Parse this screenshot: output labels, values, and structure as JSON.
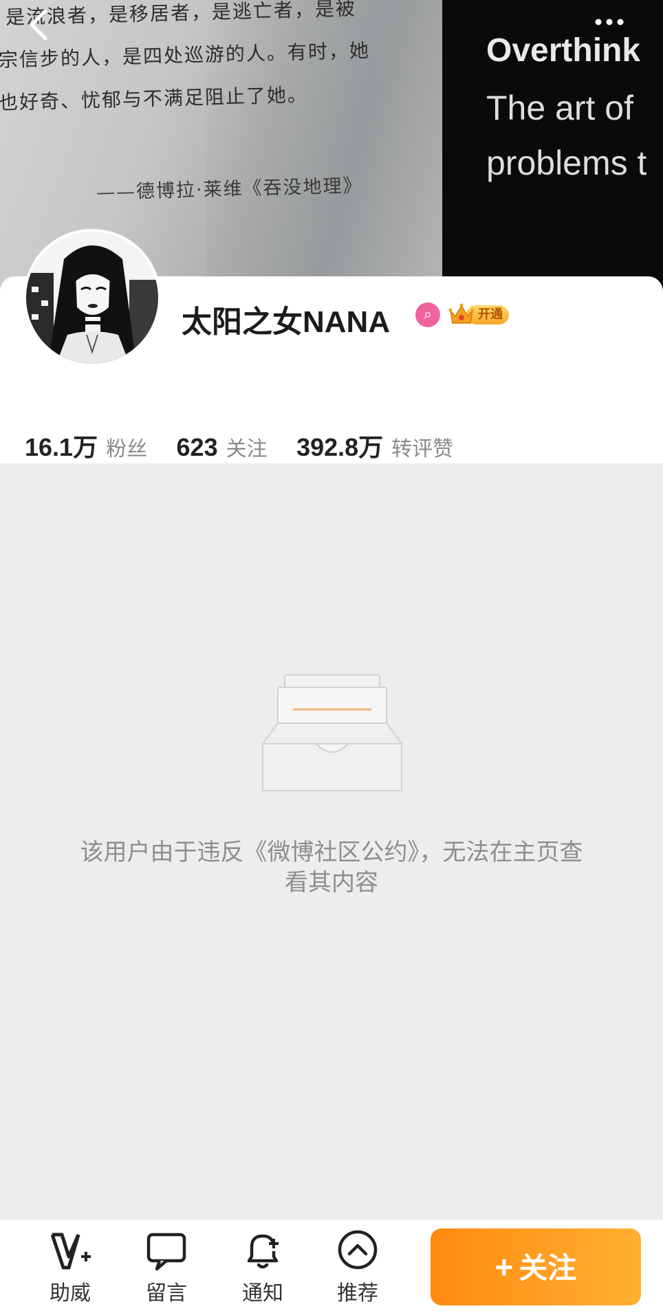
{
  "cover": {
    "book_lines": [
      "是流浪者，是移居者，是逃亡者，是被",
      "宗信步的人，是四处巡游的人。有时，她",
      "也好奇、忧郁与不满足阻止了她。",
      "——德博拉·莱维《吞没地理》"
    ],
    "right_title": "Overthink",
    "right_line2": "The art of",
    "right_line3": "problems t"
  },
  "header": {
    "back_icon": "chevron-left-icon",
    "more_icon": "more-dots-icon"
  },
  "profile": {
    "username": "太阳之女NANA",
    "pink_badge_glyph": "⌕",
    "vip_label": "开通",
    "stats": [
      {
        "number": "16.1万",
        "label": "粉丝"
      },
      {
        "number": "623",
        "label": "关注"
      },
      {
        "number": "392.8万",
        "label": "转评赞"
      }
    ]
  },
  "empty_state": {
    "icon": "empty-inbox-icon",
    "message": "该用户由于违反《微博社区公约》，无法在主页查看其内容"
  },
  "bottom_bar": {
    "items": [
      {
        "label": "助威",
        "icon": "v-plus-icon"
      },
      {
        "label": "留言",
        "icon": "chat-bubble-icon"
      },
      {
        "label": "通知",
        "icon": "bell-plus-icon"
      },
      {
        "label": "推荐",
        "icon": "chevron-up-circle-icon"
      }
    ],
    "follow_plus": "+",
    "follow_label": "关注"
  },
  "colors": {
    "accent": "#ff9a1f",
    "pink_badge": "#f0649e",
    "text_primary": "#1c1c1c",
    "text_secondary": "#8a8a8a",
    "page_bg": "#ededed"
  }
}
